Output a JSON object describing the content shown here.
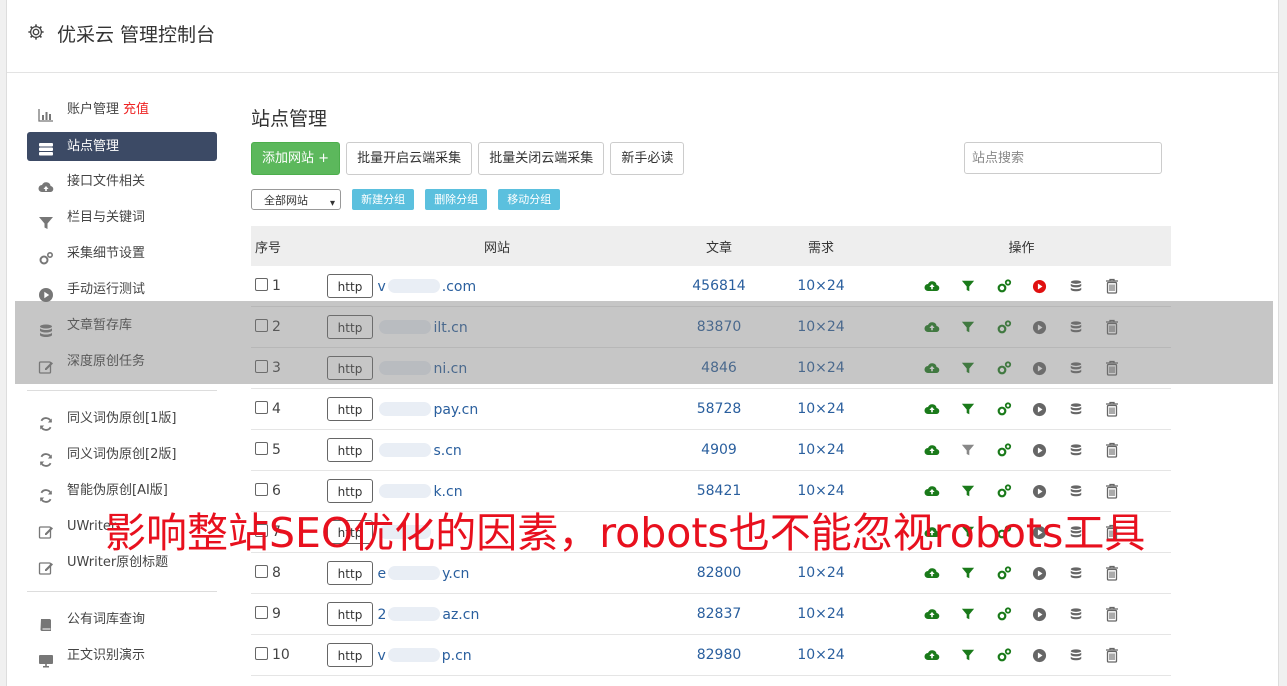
{
  "header": {
    "title": "优采云 管理控制台"
  },
  "sidebar": {
    "group1": [
      {
        "label": "账户管理",
        "badge": "充值",
        "icon": "bar-chart-icon"
      },
      {
        "label": "站点管理",
        "icon": "server-icon",
        "active": true
      },
      {
        "label": "接口文件相关",
        "icon": "cloud-upload-icon"
      },
      {
        "label": "栏目与关键词",
        "icon": "filter-icon"
      },
      {
        "label": "采集细节设置",
        "icon": "cogs-icon"
      },
      {
        "label": "手动运行测试",
        "icon": "play-icon"
      },
      {
        "label": "文章暂存库",
        "icon": "database-icon"
      },
      {
        "label": "深度原创任务",
        "icon": "edit-icon"
      }
    ],
    "group2": [
      {
        "label": "同义词伪原创[1版]",
        "icon": "refresh-icon"
      },
      {
        "label": "同义词伪原创[2版]",
        "icon": "refresh-icon"
      },
      {
        "label": "智能伪原创[AI版]",
        "icon": "refresh-icon"
      },
      {
        "label": "UWriter",
        "icon": "edit-icon"
      },
      {
        "label": "UWriter原创标题",
        "icon": "edit-icon"
      }
    ],
    "group3": [
      {
        "label": "公有词库查询",
        "icon": "book-icon"
      },
      {
        "label": "正文识别演示",
        "icon": "monitor-icon"
      }
    ]
  },
  "main": {
    "title": "站点管理",
    "buttons": {
      "add": "添加网站 +",
      "batch_on": "批量开启云端采集",
      "batch_off": "批量关闭云端采集",
      "guide": "新手必读"
    },
    "search_placeholder": "站点搜索",
    "group_select": "全部网站",
    "group_buttons": {
      "new": "新建分组",
      "delete": "删除分组",
      "move": "移动分组"
    },
    "columns": {
      "no": "序号",
      "site": "网站",
      "articles": "文章",
      "demand": "需求",
      "ops": "操作"
    },
    "rows": [
      {
        "no": "1",
        "proto": "http",
        "pre": "v",
        "post": ".com",
        "articles": "456814",
        "demand": "10×24",
        "filter_on": true,
        "play_red": true
      },
      {
        "no": "2",
        "proto": "http",
        "pre": "",
        "post": "ilt.cn",
        "articles": "83870",
        "demand": "10×24",
        "filter_on": true,
        "play_red": false
      },
      {
        "no": "3",
        "proto": "http",
        "pre": "",
        "post": "ni.cn",
        "articles": "4846",
        "demand": "10×24",
        "filter_on": true,
        "play_red": false
      },
      {
        "no": "4",
        "proto": "http",
        "pre": "",
        "post": "pay.cn",
        "articles": "58728",
        "demand": "10×24",
        "filter_on": true,
        "play_red": false
      },
      {
        "no": "5",
        "proto": "http",
        "pre": "",
        "post": "s.cn",
        "articles": "4909",
        "demand": "10×24",
        "filter_on": false,
        "play_red": false
      },
      {
        "no": "6",
        "proto": "http",
        "pre": "",
        "post": "k.cn",
        "articles": "58421",
        "demand": "10×24",
        "filter_on": true,
        "play_red": false
      },
      {
        "no": "7",
        "proto": "http",
        "pre": "",
        "post": "",
        "articles": "",
        "demand": "",
        "filter_on": true,
        "play_red": false
      },
      {
        "no": "8",
        "proto": "http",
        "pre": "e",
        "post": "y.cn",
        "articles": "82800",
        "demand": "10×24",
        "filter_on": true,
        "play_red": false
      },
      {
        "no": "9",
        "proto": "http",
        "pre": "2",
        "post": "az.cn",
        "articles": "82837",
        "demand": "10×24",
        "filter_on": true,
        "play_red": false
      },
      {
        "no": "10",
        "proto": "http",
        "pre": "v",
        "post": "p.cn",
        "articles": "82980",
        "demand": "10×24",
        "filter_on": true,
        "play_red": false
      }
    ]
  },
  "banner": {
    "text": "影响整站SEO优化的因素，robots也不能忽视robots工具"
  },
  "colors": {
    "sidebar_active": "#3c4a65",
    "green": "#5cb85c",
    "info": "#5bc0de",
    "link": "#2a5f9e",
    "banner": "#e8101e"
  }
}
